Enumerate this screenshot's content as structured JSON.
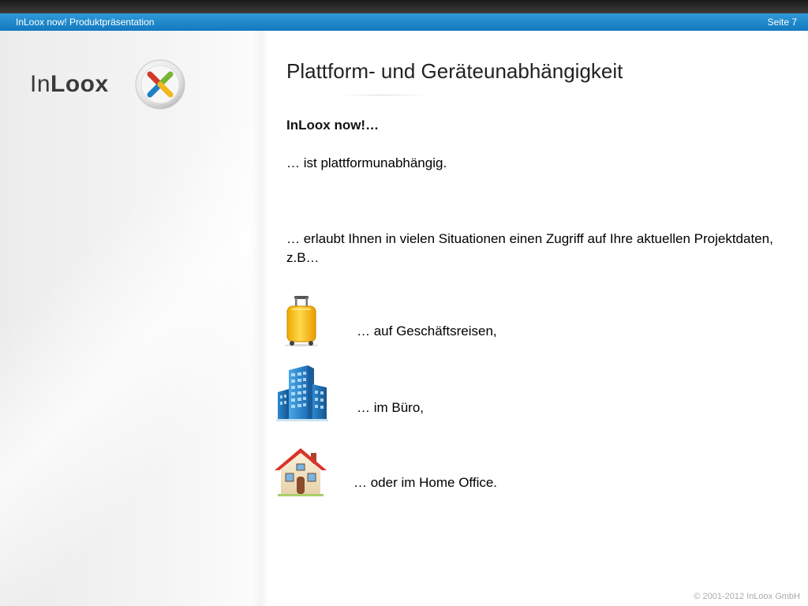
{
  "header": {
    "title": "InLoox now! Produktpräsentation",
    "page": "Seite 7"
  },
  "logo": {
    "text_regular": "In",
    "text_bold": "Loox"
  },
  "slide": {
    "title": "Plattform- und Geräteunabhängigkeit",
    "subtitle": "InLoox now!…",
    "paragraph1": "… ist plattformunabhängig.",
    "paragraph2": "… erlaubt Ihnen in vielen Situationen einen Zugriff auf Ihre aktuellen Projektdaten, z.B…",
    "items": [
      {
        "icon": "suitcase-icon",
        "label": "… auf Geschäftsreisen,"
      },
      {
        "icon": "office-building-icon",
        "label": "… im Büro,"
      },
      {
        "icon": "house-icon",
        "label": "… oder im Home Office."
      }
    ]
  },
  "footer": {
    "copyright": "© 2001-2012 InLoox GmbH"
  },
  "colors": {
    "header_bar": "#1a8ad0",
    "top_strip": "#2a2a2a",
    "logo_red": "#d4382b",
    "logo_green": "#79b530",
    "logo_blue": "#1d7fc4",
    "logo_yellow": "#f2b81c"
  }
}
